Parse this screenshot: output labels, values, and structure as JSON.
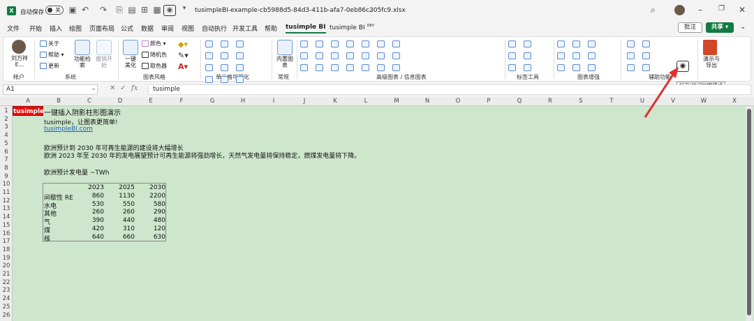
{
  "titlebar": {
    "autosave_label": "自动保存",
    "toggle_state": "关",
    "filename": "tusimpleBI-example-cb5988d5-84d3-411b-afa7-0eb86c305fc9.xlsx"
  },
  "menu": [
    "文件",
    "开始",
    "插入",
    "绘图",
    "页面布局",
    "公式",
    "数据",
    "审阅",
    "视图",
    "自动执行",
    "开发工具",
    "帮助",
    "tusimple BI",
    "tusimple BI"
  ],
  "menu_dev_suffix": "DEV",
  "comment_label": "批注",
  "share_label": "共享",
  "ribbon": {
    "account_name": "刘万祥E...",
    "about": "关于",
    "help": "帮助",
    "update": "更新",
    "func_search": "功能检索",
    "restore": "撤销开始",
    "beautify": "一键美化",
    "color": "颜色",
    "random_color": "随机色",
    "picker": "取色器",
    "builtin": "内置图表",
    "groups": [
      "帐户",
      "系统",
      "图表风格",
      "单元格可视化",
      "常规",
      "高级图表 / 信息图表",
      "标签工具",
      "图表增强",
      "辅助功能"
    ],
    "present": "演示与导出"
  },
  "tooltip": "打开/关闭护眼模式",
  "formula": {
    "namebox": "A1",
    "fx": "fx",
    "content": "tusimple"
  },
  "columns": [
    "A",
    "B",
    "C",
    "D",
    "E",
    "F",
    "G",
    "H",
    "I",
    "J",
    "K",
    "L",
    "M",
    "N",
    "O",
    "P",
    "Q",
    "R",
    "S",
    "T",
    "U",
    "V",
    "W",
    "X"
  ],
  "rows": [
    "1",
    "2",
    "3",
    "4",
    "5",
    "6",
    "7",
    "8",
    "9",
    "10",
    "11",
    "12",
    "13",
    "14",
    "15",
    "16",
    "17",
    "18",
    "19",
    "20",
    "21",
    "22",
    "23",
    "24",
    "25",
    "26"
  ],
  "sheet": {
    "a1": "tusimple",
    "b1": "一键插入阴影柱形图演示",
    "b2": "tusimple，让图表更简单!",
    "b3": "tusimpleBI.com",
    "b5": "欧洲预计到 2030 年可再生能源的建设将大幅增长",
    "b6": "欧洲 2023 年至 2030 年的发电展望预计可再生能源将强劲增长，天然气发电量将保持稳定，燃煤发电量将下降。",
    "b8": "欧洲预计发电量 ~TWh",
    "years": [
      "2023",
      "2025",
      "2030"
    ],
    "table": [
      {
        "label": "间歇性 RE",
        "v": [
          "860",
          "1130",
          "2200"
        ]
      },
      {
        "label": "水电",
        "v": [
          "530",
          "550",
          "580"
        ]
      },
      {
        "label": "其他",
        "v": [
          "260",
          "260",
          "290"
        ]
      },
      {
        "label": "气",
        "v": [
          "390",
          "440",
          "480"
        ]
      },
      {
        "label": "煤",
        "v": [
          "420",
          "310",
          "120"
        ]
      },
      {
        "label": "核",
        "v": [
          "640",
          "660",
          "630"
        ]
      }
    ]
  },
  "colors": {
    "excel_green": "#107c41",
    "sheet_bg": "#cde6cc",
    "tag_red": "#e01010",
    "arrow": "#e03030"
  }
}
